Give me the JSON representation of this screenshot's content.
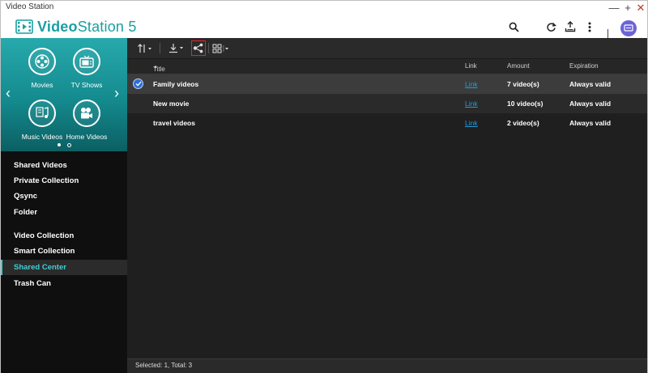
{
  "window": {
    "title": "Video Station"
  },
  "app": {
    "name_bold": "Video",
    "name_rest": "Station 5",
    "accent": "#1a9fa1"
  },
  "header_icons": [
    "search-icon",
    "refresh-icon",
    "upload-icon",
    "more-icon",
    "avatar-icon"
  ],
  "categories": [
    {
      "label": "Movies",
      "icon": "film-reel-icon"
    },
    {
      "label": "TV Shows",
      "icon": "tv-icon"
    },
    {
      "label": "Music Videos",
      "icon": "music-note-icon"
    },
    {
      "label": "Home Videos",
      "icon": "video-camera-icon"
    }
  ],
  "sidebar": {
    "groups": [
      [
        {
          "label": "Shared Videos"
        },
        {
          "label": "Private Collection"
        },
        {
          "label": "Qsync"
        },
        {
          "label": "Folder"
        }
      ],
      [
        {
          "label": "Video Collection"
        },
        {
          "label": "Smart Collection"
        },
        {
          "label": "Shared Center",
          "active": true
        },
        {
          "label": "Trash Can"
        }
      ]
    ]
  },
  "table": {
    "columns": {
      "title": "Title",
      "link": "Link",
      "amount": "Amount",
      "expiration": "Expiration"
    },
    "rows": [
      {
        "title": "Family videos",
        "link": "Link",
        "amount": "7 video(s)",
        "expiration": "Always valid",
        "selected": true
      },
      {
        "title": "New movie",
        "link": "Link",
        "amount": "10 video(s)",
        "expiration": "Always valid",
        "selected": false
      },
      {
        "title": "travel videos",
        "link": "Link",
        "amount": "2 video(s)",
        "expiration": "Always valid",
        "selected": false
      }
    ]
  },
  "status": {
    "text": "Selected: 1, Total: 3"
  }
}
